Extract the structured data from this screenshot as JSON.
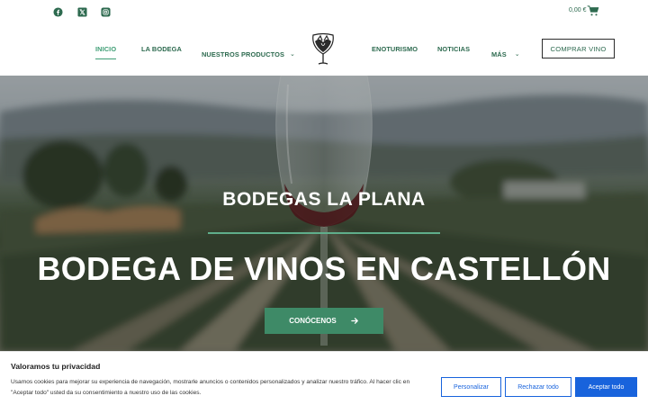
{
  "topbar": {
    "social": [
      {
        "icon": "facebook-icon"
      },
      {
        "icon": "x-twitter-icon"
      },
      {
        "icon": "instagram-icon"
      }
    ],
    "cart_total": "0,00 €",
    "cart_icon": "shopping-cart-icon"
  },
  "nav": {
    "items": [
      {
        "label": "INICIO",
        "active": true
      },
      {
        "label": "LA BODEGA"
      },
      {
        "label": "NUESTROS PRODUCTOS",
        "has_dropdown": true
      },
      {
        "label": "ENOTURISMO"
      },
      {
        "label": "NOTICIAS"
      },
      {
        "label": "MÁS",
        "has_dropdown": true
      }
    ],
    "logo": "winery-logo-icon",
    "buy_label": "COMPRAR VINO"
  },
  "hero": {
    "subtitle": "BODEGAS LA PLANA",
    "title": "BODEGA DE VINOS EN CASTELLÓN",
    "button_label": "CONÓCENOS",
    "button_icon": "arrow-right-icon"
  },
  "cookie": {
    "title": "Valoramos tu privacidad",
    "text": "Usamos cookies para mejorar su experiencia de navegación, mostrarle anuncios o contenidos personalizados y analizar nuestro tráfico. Al hacer clic en \"Aceptar todo\" usted da su consentimiento a nuestro uso de las cookies.",
    "customize_label": "Personalizar",
    "reject_label": "Rechazar todo",
    "accept_label": "Aceptar todo"
  },
  "colors": {
    "brand_green": "#2d6a4f",
    "accent_green": "#3f9e75",
    "hero_button": "#3e8a67",
    "cookie_blue": "#1863dc"
  }
}
